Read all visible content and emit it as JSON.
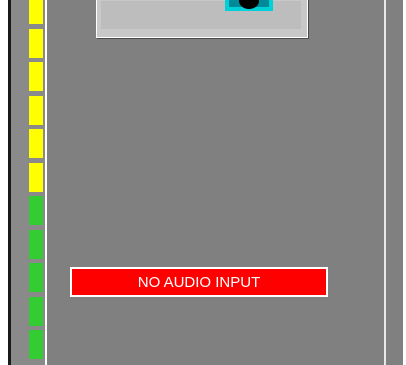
{
  "status": {
    "message": "NO AUDIO INPUT",
    "background_color": "#ff0000",
    "text_color": "#ffffff"
  },
  "audio_meter": {
    "segments": [
      "yellow",
      "yellow",
      "yellow",
      "yellow",
      "yellow",
      "yellow",
      "green",
      "green",
      "green",
      "green",
      "green"
    ],
    "colors": {
      "yellow": "#ffff00",
      "green": "#33cc33"
    }
  },
  "preview": {
    "icon": "speaker-icon",
    "icon_color": "#00d0d8"
  },
  "panel": {
    "background_color": "#808080"
  }
}
